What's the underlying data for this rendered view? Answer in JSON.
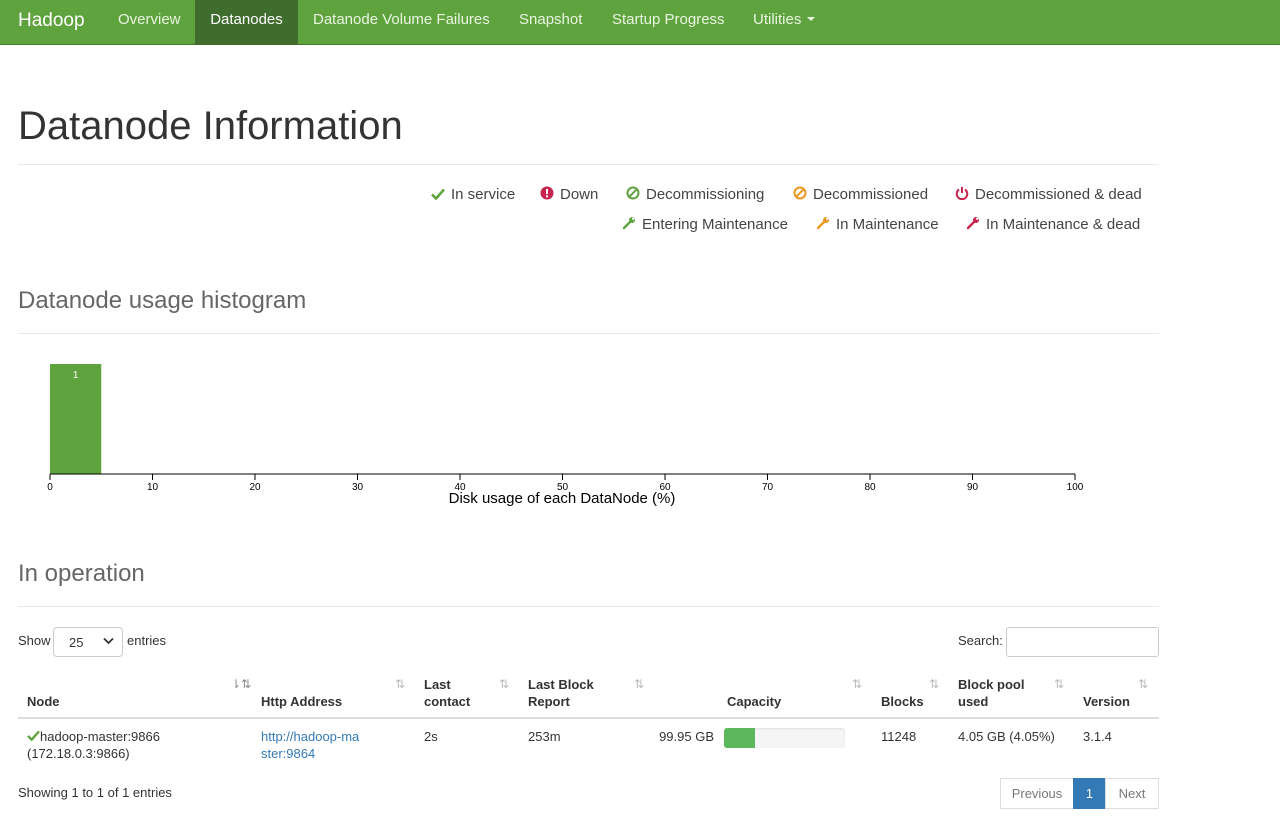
{
  "navbar": {
    "brand": "Hadoop",
    "items": [
      {
        "label": "Overview"
      },
      {
        "label": "Datanodes"
      },
      {
        "label": "Datanode Volume Failures"
      },
      {
        "label": "Snapshot"
      },
      {
        "label": "Startup Progress"
      },
      {
        "label": "Utilities"
      }
    ],
    "active_item": "Datanodes"
  },
  "page_title": "Datanode Information",
  "legend": [
    {
      "label": "In service",
      "icon": "check-icon",
      "color": "#5fa33e"
    },
    {
      "label": "Down",
      "icon": "exclamation-circle-icon",
      "color": "#c7254e"
    },
    {
      "label": "Decommissioning",
      "icon": "ban-icon",
      "color": "#5fa33e"
    },
    {
      "label": "Decommissioned",
      "icon": "ban-icon",
      "color": "#ec971f"
    },
    {
      "label": "Decommissioned & dead",
      "icon": "power-icon",
      "color": "#c7254e"
    },
    {
      "label": "Entering Maintenance",
      "icon": "wrench-icon",
      "color": "#5fa33e"
    },
    {
      "label": "In Maintenance",
      "icon": "wrench-icon",
      "color": "#ec971f"
    },
    {
      "label": "In Maintenance & dead",
      "icon": "wrench-icon",
      "color": "#c7254e"
    }
  ],
  "histogram": {
    "title": "Datanode usage histogram",
    "chart_data": {
      "type": "bar",
      "bins": [
        {
          "x0": 0,
          "x1": 5,
          "count": 1
        }
      ],
      "xlabel": "Disk usage of each DataNode (%)",
      "xlim": [
        0,
        100
      ],
      "xticks": [
        0,
        10,
        20,
        30,
        40,
        50,
        60,
        70,
        80,
        90,
        100
      ],
      "bar_color": "#5fa33e"
    }
  },
  "operation": {
    "title": "In operation",
    "show_label": "Show",
    "page_size": "25",
    "entries_label": "entries",
    "search_label": "Search:",
    "search_value": "",
    "columns": [
      "Node",
      "Http Address",
      "Last contact",
      "Last Block Report",
      "Capacity",
      "Blocks",
      "Block pool used",
      "Version"
    ],
    "rows": [
      {
        "node_name": "hadoop-master:9866",
        "node_ip": "(172.18.0.3:9866)",
        "http_address": "http://hadoop-master:9864",
        "last_contact": "2s",
        "last_block_report": "253m",
        "capacity": "99.95 GB",
        "capacity_used_fraction": 0.26,
        "blocks": "11248",
        "block_pool_used": "4.05 GB (4.05%)",
        "version": "3.1.4"
      }
    ],
    "info": "Showing 1 to 1 of 1 entries",
    "pagination": {
      "previous": "Previous",
      "current": "1",
      "next": "Next"
    }
  }
}
